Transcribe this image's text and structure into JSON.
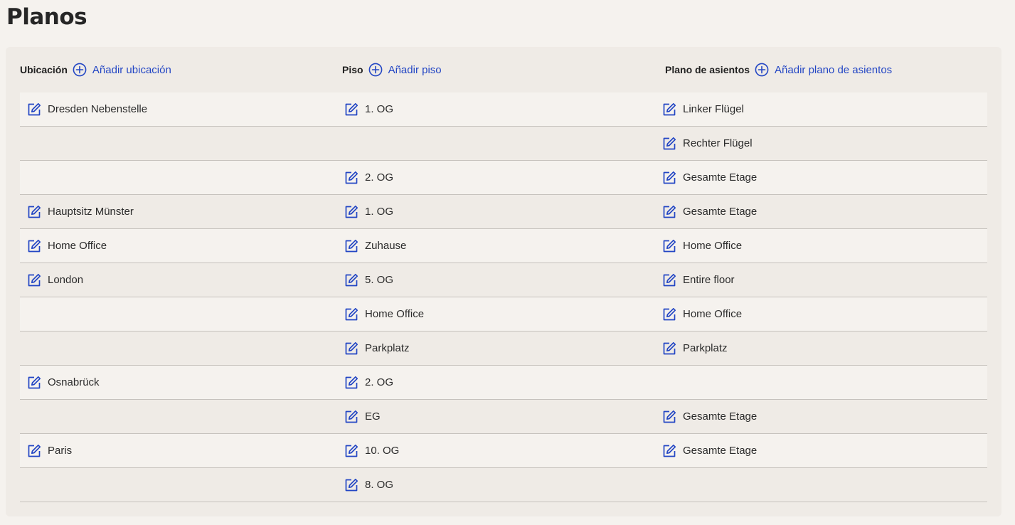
{
  "page": {
    "title": "Planos"
  },
  "colors": {
    "accent": "#2346c4",
    "background": "#f5f2ee",
    "card": "#efebe6",
    "divider": "#c6c2bd"
  },
  "headers": [
    {
      "label": "Ubicación",
      "add_label": "Añadir ubicación",
      "icon": "plus-circle-icon"
    },
    {
      "label": "Piso",
      "add_label": "Añadir piso",
      "icon": "plus-circle-icon"
    },
    {
      "label": "Plano de asientos",
      "add_label": "Añadir plano de asientos",
      "icon": "plus-circle-icon"
    }
  ],
  "row_icon": "edit-icon",
  "rows": [
    [
      "Dresden Nebenstelle",
      "1. OG",
      "Linker Flügel"
    ],
    [
      "",
      "",
      "Rechter Flügel"
    ],
    [
      "",
      "2. OG",
      "Gesamte Etage"
    ],
    [
      "Hauptsitz Münster",
      "1. OG",
      "Gesamte Etage"
    ],
    [
      "Home Office",
      "Zuhause",
      "Home Office"
    ],
    [
      "London",
      "5. OG",
      "Entire floor"
    ],
    [
      "",
      "Home Office",
      "Home Office"
    ],
    [
      "",
      "Parkplatz",
      "Parkplatz"
    ],
    [
      "Osnabrück",
      "2. OG",
      ""
    ],
    [
      "",
      "EG",
      "Gesamte Etage"
    ],
    [
      "Paris",
      "10. OG",
      "Gesamte Etage"
    ],
    [
      "",
      "8. OG",
      ""
    ]
  ]
}
